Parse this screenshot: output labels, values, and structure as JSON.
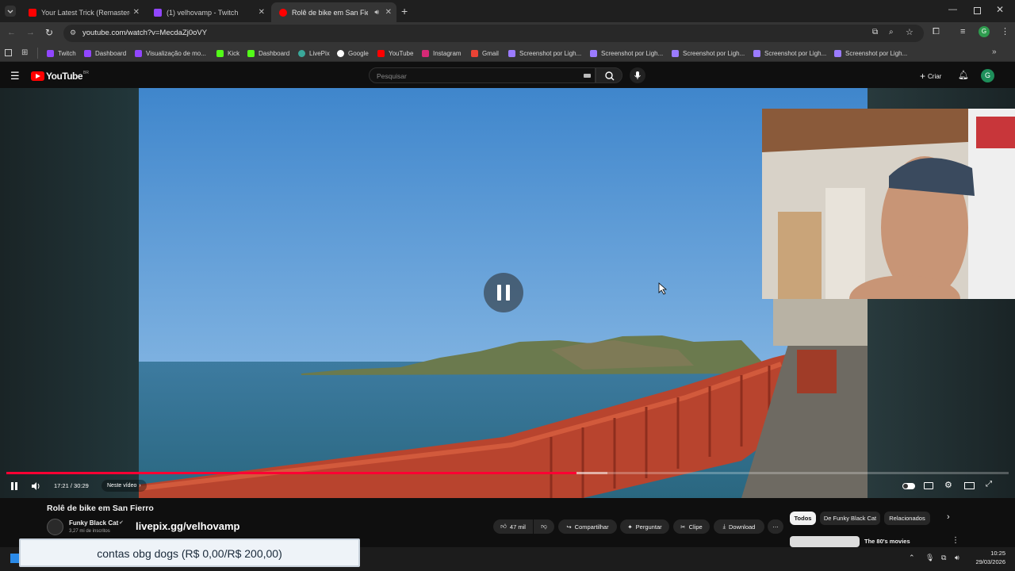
{
  "browser": {
    "tabs": [
      {
        "title": "Your Latest Trick (Remastered 1",
        "favicon": "youtube-icon",
        "active": false
      },
      {
        "title": "(1) velhovamp - Twitch",
        "favicon": "twitch-icon",
        "active": false
      },
      {
        "title": "Rolê de bike em San Fierro",
        "favicon": "youtube-icon",
        "active": true
      }
    ],
    "url": "youtube.com/watch?v=MecdaZj0oVY",
    "bookmarks": [
      "Twitch",
      "Dashboard",
      "Visualização de mo...",
      "Kick",
      "Dashboard",
      "LivePix",
      "Google",
      "YouTube",
      "Instagram",
      "Gmail",
      "Screenshot por Ligh...",
      "Screenshot por Ligh...",
      "Screenshot por Ligh...",
      "Screenshot por Ligh...",
      "Screenshot por Ligh..."
    ],
    "profile_initial": "G"
  },
  "youtube": {
    "logo": "YouTube",
    "logo_region": "BR",
    "search_placeholder": "Pesquisar",
    "create_label": "Criar",
    "avatar_initial": "G"
  },
  "player": {
    "time": "17:21 / 30:29",
    "chapter": "Neste vídeo",
    "progress": 0.569,
    "buffered": 0.6
  },
  "video": {
    "title": "Rolê de bike em San Fierro",
    "channel": "Funky Black Cat",
    "subscribers": "3,27 mi de inscritos",
    "likes": "47 mil",
    "share": "Compartilhar",
    "ask": "Perguntar",
    "clip": "Clipe",
    "download": "Download"
  },
  "overlay": {
    "livepix": "livepix.gg/velhovamp",
    "goal_text": "contas obg dogs (R$ 0,00/R$ 200,00)"
  },
  "sidebar": {
    "chips": [
      "Todos",
      "De Funky Black Cat",
      "Relacionados"
    ],
    "next_title": "The 80's movies"
  },
  "taskbar": {
    "time": "10:25",
    "date": "29/03/2026"
  },
  "colors": {
    "youtube_red": "#ff0000",
    "twitch_purple": "#9146ff",
    "kick_green": "#53fc18",
    "progress_red": "#ff0033"
  }
}
